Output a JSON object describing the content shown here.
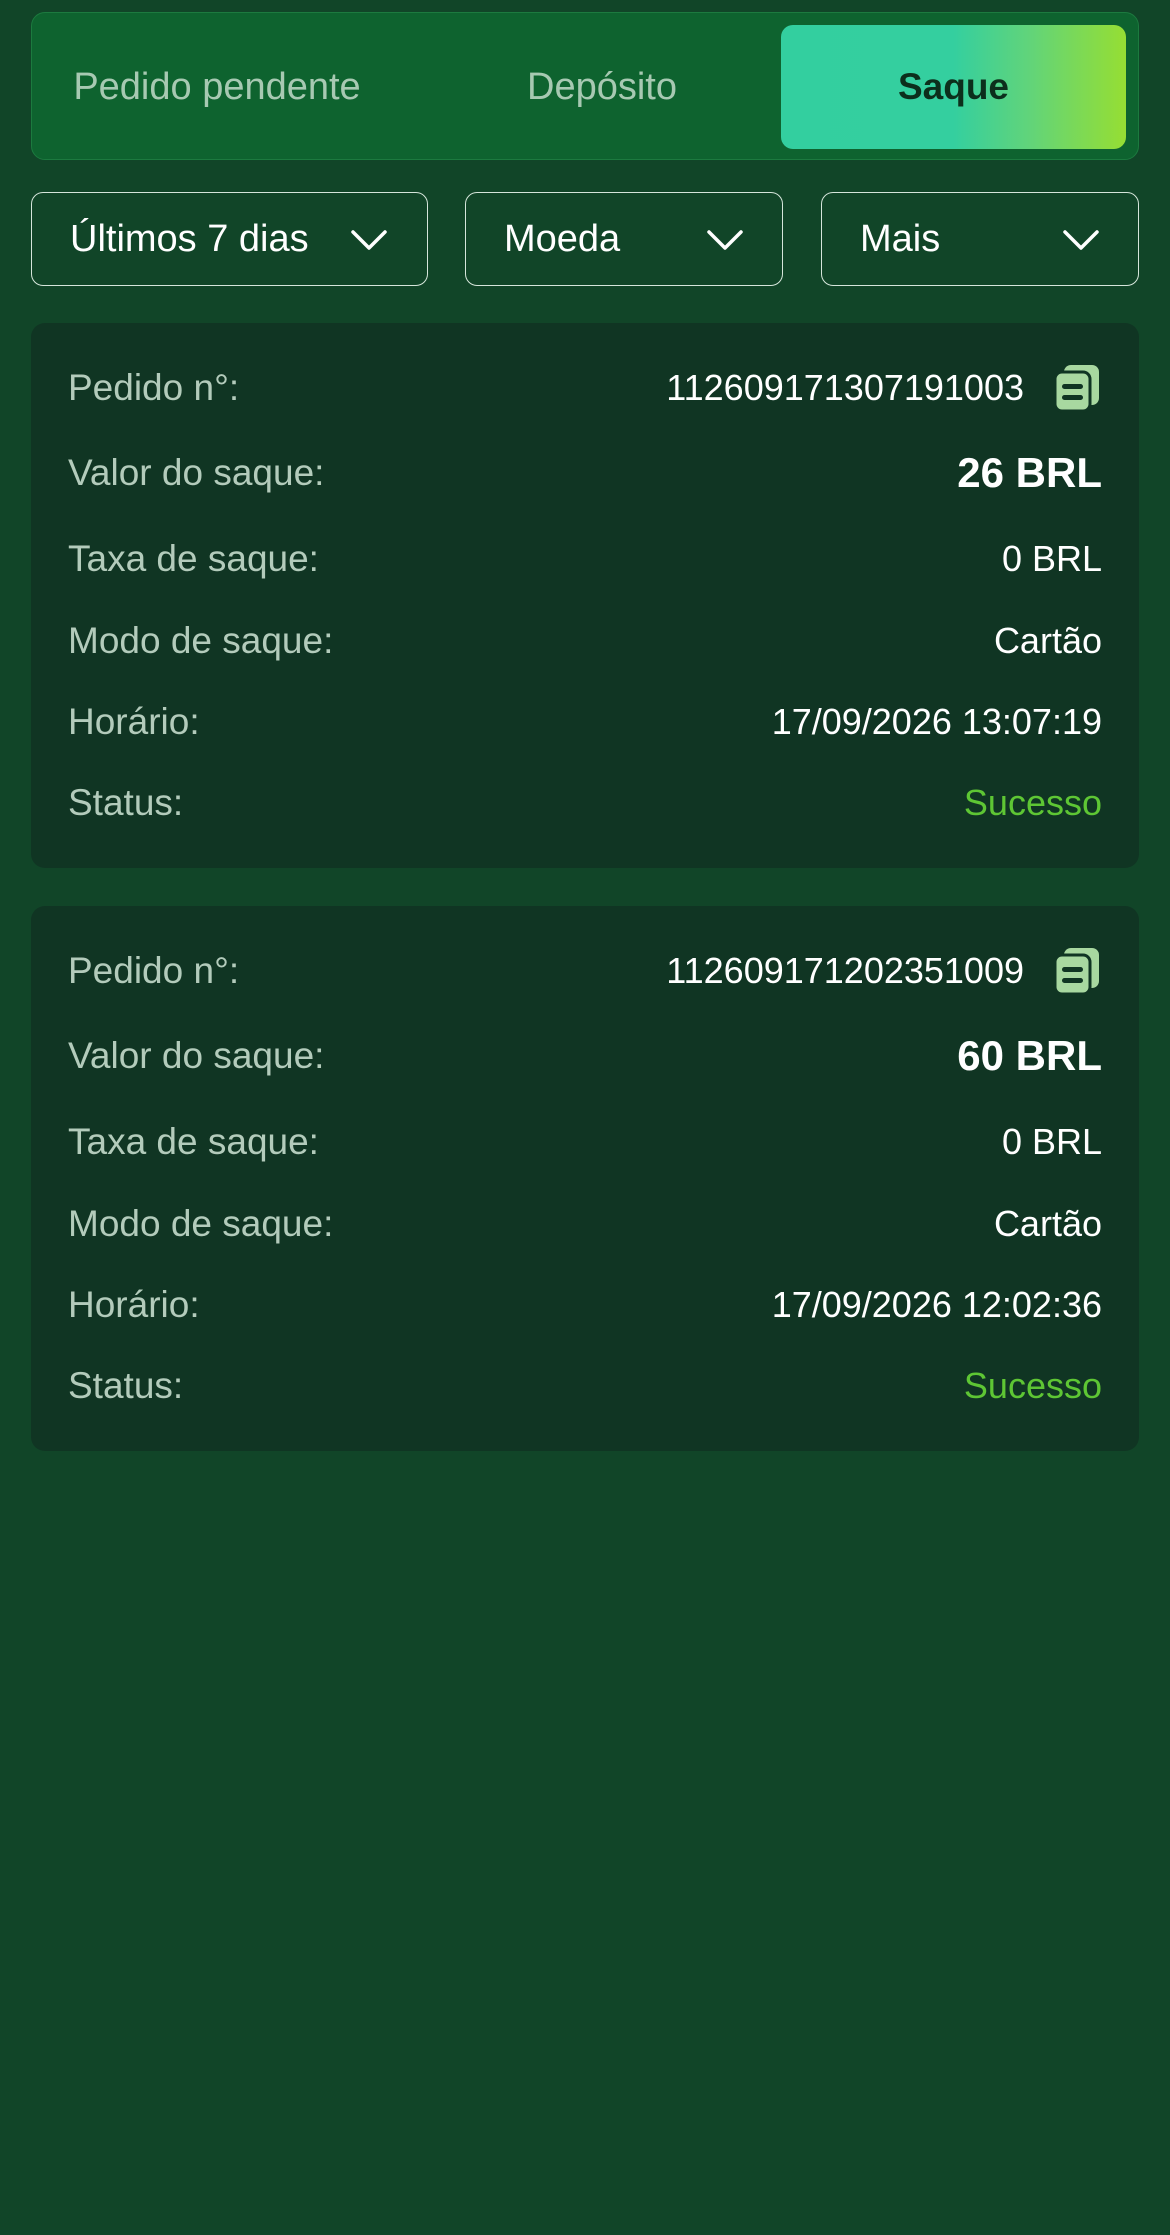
{
  "tabs": {
    "pending_label": "Pedido pendente",
    "deposit_label": "Depósito",
    "withdraw_label": "Saque",
    "active": "Saque"
  },
  "filters": {
    "period_label": "Últimos 7 dias",
    "currency_label": "Moeda",
    "more_label": "Mais"
  },
  "labels": {
    "order_no": "Pedido n°:",
    "amount": "Valor do saque:",
    "fee": "Taxa de saque:",
    "mode": "Modo de saque:",
    "time": "Horário:",
    "status": "Status:"
  },
  "orders": [
    {
      "order_no": "112609171307191003",
      "amount": "26 BRL",
      "fee": "0 BRL",
      "mode": "Cartão",
      "time": "17/09/2026 13:07:19",
      "status": "Sucesso"
    },
    {
      "order_no": "112609171202351009",
      "amount": "60 BRL",
      "fee": "0 BRL",
      "mode": "Cartão",
      "time": "17/09/2026 12:02:36",
      "status": "Sucesso"
    }
  ],
  "colors": {
    "background": "#114528",
    "card": "#103523",
    "status_success": "#5ec634",
    "active_tab_gradient_start": "#33cf9f",
    "active_tab_gradient_end": "#96de33"
  },
  "icons": {
    "copy": "copy-icon",
    "dropdown": "chevron-down-icon"
  }
}
